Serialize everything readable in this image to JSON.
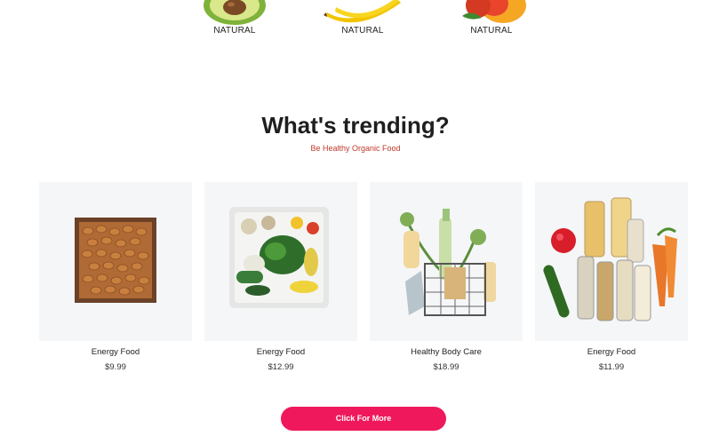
{
  "categories": [
    {
      "label": "NATURAL",
      "icon": "avocado-icon"
    },
    {
      "label": "NATURAL",
      "icon": "banana-icon"
    },
    {
      "label": "NATURAL",
      "icon": "mango-icon"
    }
  ],
  "trending": {
    "title": "What's trending?",
    "subtitle": "Be Healthy Organic Food"
  },
  "products": [
    {
      "name": "Energy Food",
      "price": "$9.99",
      "image": "almonds-tray-image"
    },
    {
      "name": "Energy Food",
      "price": "$12.99",
      "image": "vegetable-box-image"
    },
    {
      "name": "Healthy Body Care",
      "price": "$18.99",
      "image": "body-care-basket-image"
    },
    {
      "name": "Energy Food",
      "price": "$11.99",
      "image": "jars-and-vegetables-image"
    }
  ],
  "cta": {
    "label": "Click For More"
  },
  "colors": {
    "accent": "#f0185c",
    "subtitle": "#c0392b",
    "card_bg": "#f5f6f8"
  }
}
